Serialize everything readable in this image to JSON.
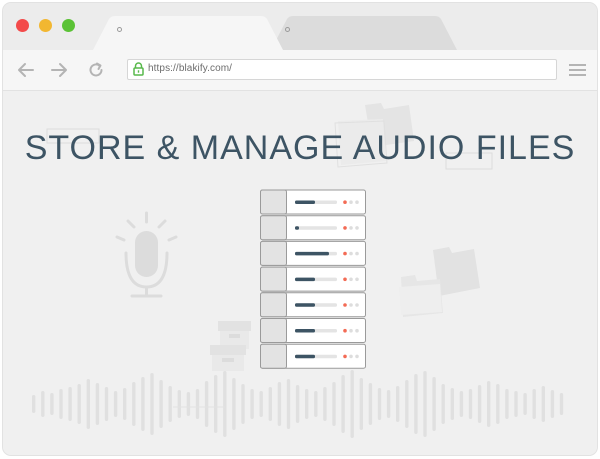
{
  "browser": {
    "window_controls": [
      "close",
      "minimize",
      "maximize"
    ],
    "tabs": [
      {
        "label": "",
        "active": true
      },
      {
        "label": "",
        "active": false
      }
    ],
    "address_bar": {
      "url": "https://blakify.com/",
      "secure": true
    },
    "nav_icons": [
      "arrow-left-icon",
      "arrow-right-icon",
      "reload-icon",
      "hamburger-menu-icon"
    ]
  },
  "page": {
    "headline": "STORE & MANAGE AUDIO FILES",
    "illustration": {
      "server_units": 7,
      "decorations": [
        "microphone-icon",
        "folder-icon",
        "file-box-icon",
        "sound-wave"
      ]
    }
  },
  "colors": {
    "headline": "#3d5464",
    "server_bar": "#3d5464",
    "server_led": "#f36b55",
    "window_bg": "#ececec",
    "content_bg": "#f0f0f0"
  }
}
